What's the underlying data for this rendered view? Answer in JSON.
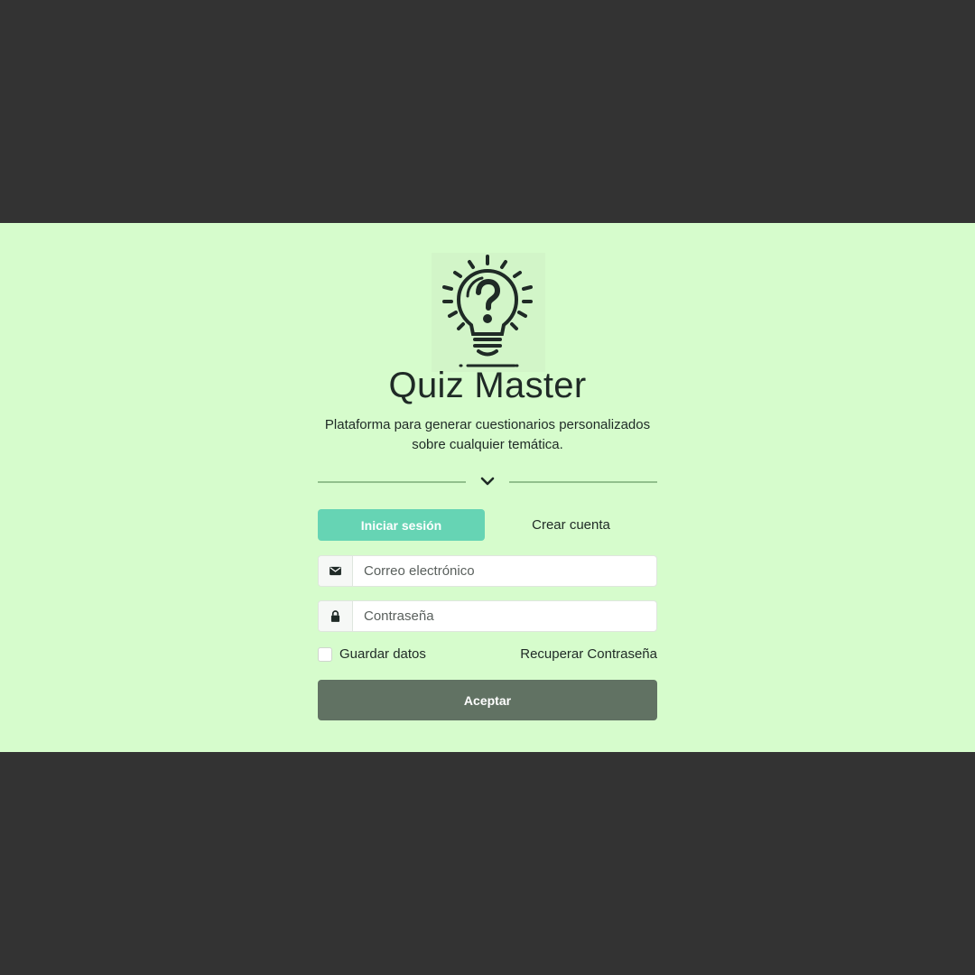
{
  "app": {
    "title": "Quiz Master",
    "subtitle": "Plataforma para generar cuestionarios personalizados sobre cualquier temática.",
    "logo_icon": "lightbulb-question-icon"
  },
  "tabs": [
    {
      "label": "Iniciar sesión",
      "active": true
    },
    {
      "label": "Crear cuenta",
      "active": false
    }
  ],
  "form": {
    "email": {
      "placeholder": "Correo electrónico",
      "value": "",
      "icon": "envelope-icon"
    },
    "password": {
      "placeholder": "Contraseña",
      "value": "",
      "icon": "lock-icon"
    },
    "remember_label": "Guardar datos",
    "remember_checked": false,
    "recover_label": "Recuperar Contraseña",
    "submit_label": "Aceptar"
  },
  "colors": {
    "page_background": "#333333",
    "band_background": "#d6fccc",
    "active_tab": "#66d4b4",
    "submit_button": "#617263",
    "divider": "#92c08d",
    "text": "#1f2a26"
  }
}
